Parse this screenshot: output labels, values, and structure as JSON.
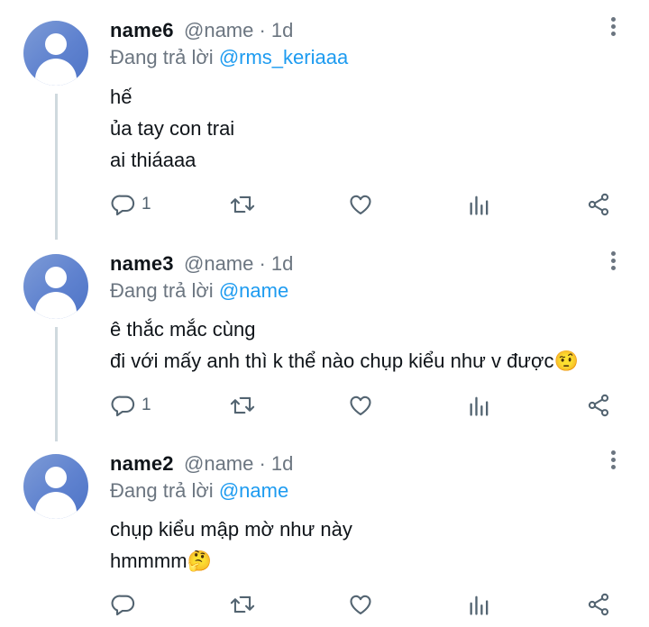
{
  "tweets": [
    {
      "name": "name6",
      "handle": "@name · 1d",
      "replying_prefix": "Đang trả lời ",
      "replying_to": "@rms_keriaaa",
      "lines": [
        "hế",
        "ủa tay con trai",
        "ai thiáaaa"
      ],
      "reply_count": "1"
    },
    {
      "name": "name3",
      "handle": "@name · 1d",
      "replying_prefix": "Đang trả lời ",
      "replying_to": "@name",
      "lines": [
        "ê thắc mắc cùng",
        "đi với mấy anh thì k thể nào chụp kiểu như v được🤨"
      ],
      "reply_count": "1"
    },
    {
      "name": "name2",
      "handle": "@name · 1d",
      "replying_prefix": "Đang trả lời ",
      "replying_to": "@name",
      "lines": [
        "chụp kiểu mập mờ như này",
        "hmmmm🤔"
      ],
      "reply_count": ""
    }
  ],
  "icons": {
    "reply": "reply-icon",
    "retweet": "retweet-icon",
    "like": "heart-icon",
    "views": "analytics-icon",
    "share": "share-icon",
    "more": "more-vertical-icon"
  },
  "colors": {
    "text": "#0f1419",
    "secondary": "#6b7580",
    "mention": "#1d9bf0",
    "icon": "#536471",
    "avatar": "#6a8ad0"
  }
}
